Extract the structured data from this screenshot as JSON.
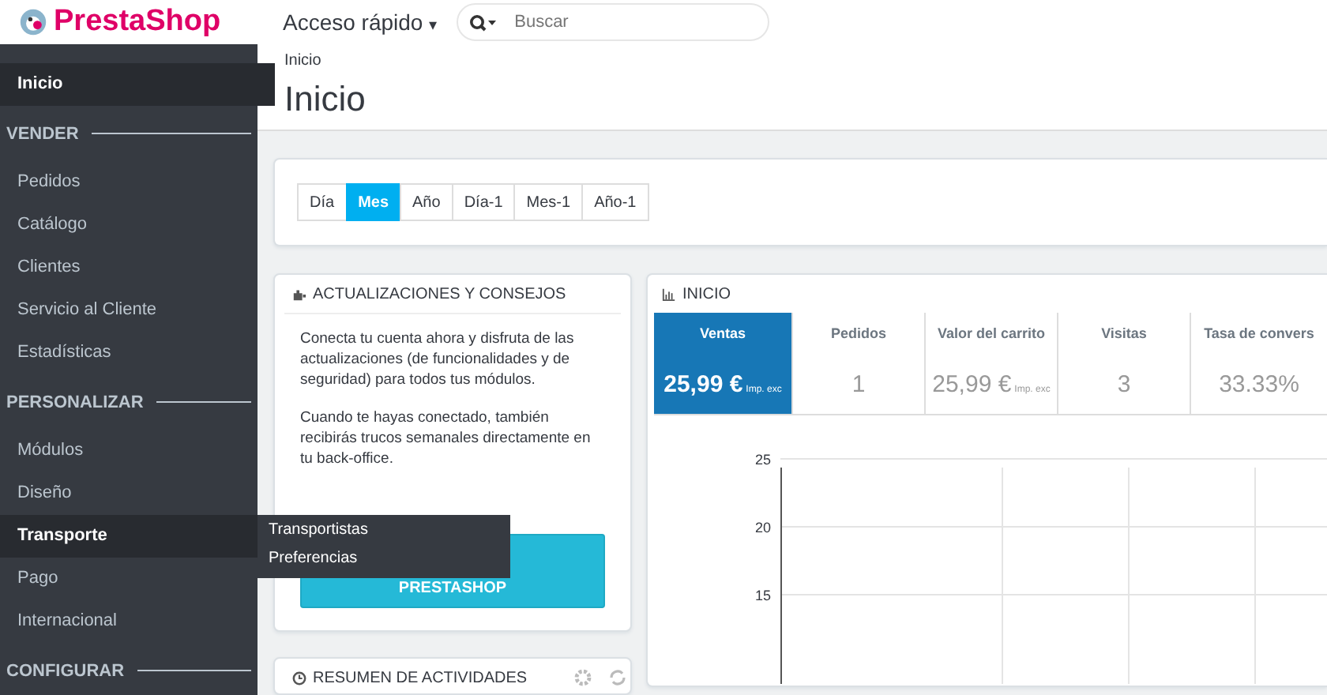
{
  "header": {
    "logo": "PrestaShop",
    "quick_access": "Acceso rápido",
    "quick_access_caret": "▾",
    "search": {
      "placeholder": "Buscar"
    }
  },
  "sidebar": {
    "sections": [
      {
        "items": [
          {
            "label": "Inicio",
            "selected": true
          }
        ]
      },
      {
        "heading": "VENDER",
        "items": [
          {
            "label": "Pedidos",
            "selected": false
          },
          {
            "label": "Catálogo",
            "selected": false
          },
          {
            "label": "Clientes",
            "selected": false
          },
          {
            "label": "Servicio al Cliente",
            "selected": false
          },
          {
            "label": "Estadísticas",
            "selected": false
          }
        ]
      },
      {
        "heading": "PERSONALIZAR",
        "items": [
          {
            "label": "Módulos",
            "selected": false
          },
          {
            "label": "Diseño",
            "selected": false
          },
          {
            "label": "Transporte",
            "selected": false,
            "expanded": true,
            "children": [
              {
                "label": "Transportistas"
              },
              {
                "label": "Preferencias"
              }
            ]
          },
          {
            "label": "Pago",
            "selected": false
          },
          {
            "label": "Internacional",
            "selected": false
          }
        ]
      },
      {
        "heading": "CONFIGURAR"
      }
    ]
  },
  "breadcrumb": "Inicio",
  "page_title": "Inicio",
  "periods": [
    {
      "label": "Día",
      "selected": false
    },
    {
      "label": "Mes",
      "selected": true
    },
    {
      "label": "Año",
      "selected": false
    },
    {
      "label": "Día-1",
      "selected": false
    },
    {
      "label": "Mes-1",
      "selected": false
    },
    {
      "label": "Año-1",
      "selected": false
    }
  ],
  "news_panel": {
    "title": "ACTUALIZACIONES Y CONSEJOS",
    "paragraphs": [
      "Conecta tu cuenta ahora y disfruta de las actualizaciones (de funcionalidades y de seguridad) para todos tus módulos.",
      "Cuando te hayas conectado, también recibirás trucos semanales directamente en tu back-office."
    ],
    "button": "PRESTASHOP"
  },
  "activity_panel": {
    "title": "RESUMEN DE ACTIVIDADES"
  },
  "dashboard": {
    "title": "INICIO",
    "kpis": [
      {
        "label": "Ventas",
        "value": "25,99 €",
        "suffix": "Imp. exc",
        "selected": true
      },
      {
        "label": "Pedidos",
        "value": "1",
        "selected": false
      },
      {
        "label": "Valor del carrito",
        "value": "25,99 €",
        "suffix": "Imp. exc",
        "selected": false
      },
      {
        "label": "Visitas",
        "value": "3",
        "selected": false
      },
      {
        "label": "Tasa de convers",
        "value": "33.33%",
        "selected": false
      }
    ],
    "chart_ticks": [
      "25",
      "20",
      "15"
    ]
  }
}
